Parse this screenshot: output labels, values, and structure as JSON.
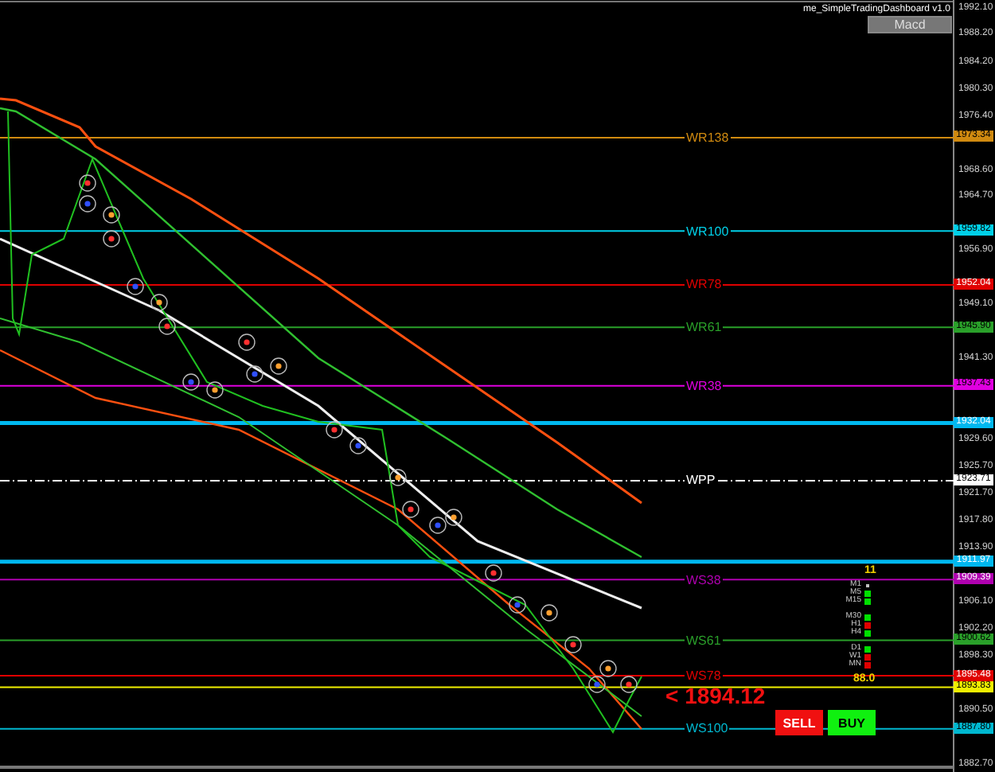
{
  "indicator_title": "me_SimpleTradingDashboard v1.0",
  "macd_button": {
    "label": "Macd"
  },
  "price_axis": [
    "1992.10",
    "1988.20",
    "1984.20",
    "1980.30",
    "1976.40",
    "1968.60",
    "1964.70",
    "1956.90",
    "1949.10",
    "1941.30",
    "1929.60",
    "1925.70",
    "1921.70",
    "1917.80",
    "1913.90",
    "1906.10",
    "1902.20",
    "1898.30",
    "1890.50",
    "1882.70"
  ],
  "levels": [
    {
      "label": "WR138",
      "tag": "1973.34",
      "color": "#d08a10",
      "kind": "solid"
    },
    {
      "label": "WR100",
      "tag": "1959.82",
      "color": "#00d0e8",
      "kind": "solid"
    },
    {
      "label": "WR78",
      "tag": "1952.04",
      "color": "#e00000",
      "kind": "solid"
    },
    {
      "label": "WR61",
      "tag": "1945.90",
      "color": "#2aa02a",
      "kind": "solid"
    },
    {
      "label": "WR38",
      "tag": "1937.43",
      "color": "#e000e0",
      "kind": "solid"
    },
    {
      "tag": "1932.04",
      "color": "#00b8f0",
      "kind": "thick"
    },
    {
      "label": "WPP",
      "tag": "1923.71",
      "color": "#ffffff",
      "kind": "dashdot"
    },
    {
      "tag": "1911.97",
      "color": "#00b8f0",
      "kind": "thick"
    },
    {
      "label": "WS38",
      "tag": "1909.39",
      "color": "#b000b0",
      "kind": "solid"
    },
    {
      "label": "WS61",
      "tag": "1900.62",
      "color": "#2aa02a",
      "kind": "solid"
    },
    {
      "label": "WS78",
      "tag": "1895.48",
      "color": "#e00000",
      "kind": "solid"
    },
    {
      "tag": "1893.83",
      "color": "#f0f000",
      "kind": "solid"
    },
    {
      "label": "WS100",
      "tag": "1887.80",
      "color": "#00b8d0",
      "kind": "solid"
    }
  ],
  "signal_count": "11",
  "timeframes": [
    {
      "label": "M1",
      "color": "#c0c0c0"
    },
    {
      "label": "M5",
      "color": "#00e000"
    },
    {
      "label": "M15",
      "color": "#00e000"
    },
    {
      "label": "M30",
      "color": "#00e000"
    },
    {
      "label": "H1",
      "color": "#e00000"
    },
    {
      "label": "H4",
      "color": "#00e000"
    },
    {
      "label": "D1",
      "color": "#00e000"
    },
    {
      "label": "W1",
      "color": "#e00000"
    },
    {
      "label": "MN",
      "color": "#e00000"
    }
  ],
  "score": "88.0",
  "current_price": "< 1894.12",
  "buttons": [
    {
      "label": "SELL",
      "kind": "sell"
    },
    {
      "label": "BUY",
      "kind": "buy"
    }
  ]
}
